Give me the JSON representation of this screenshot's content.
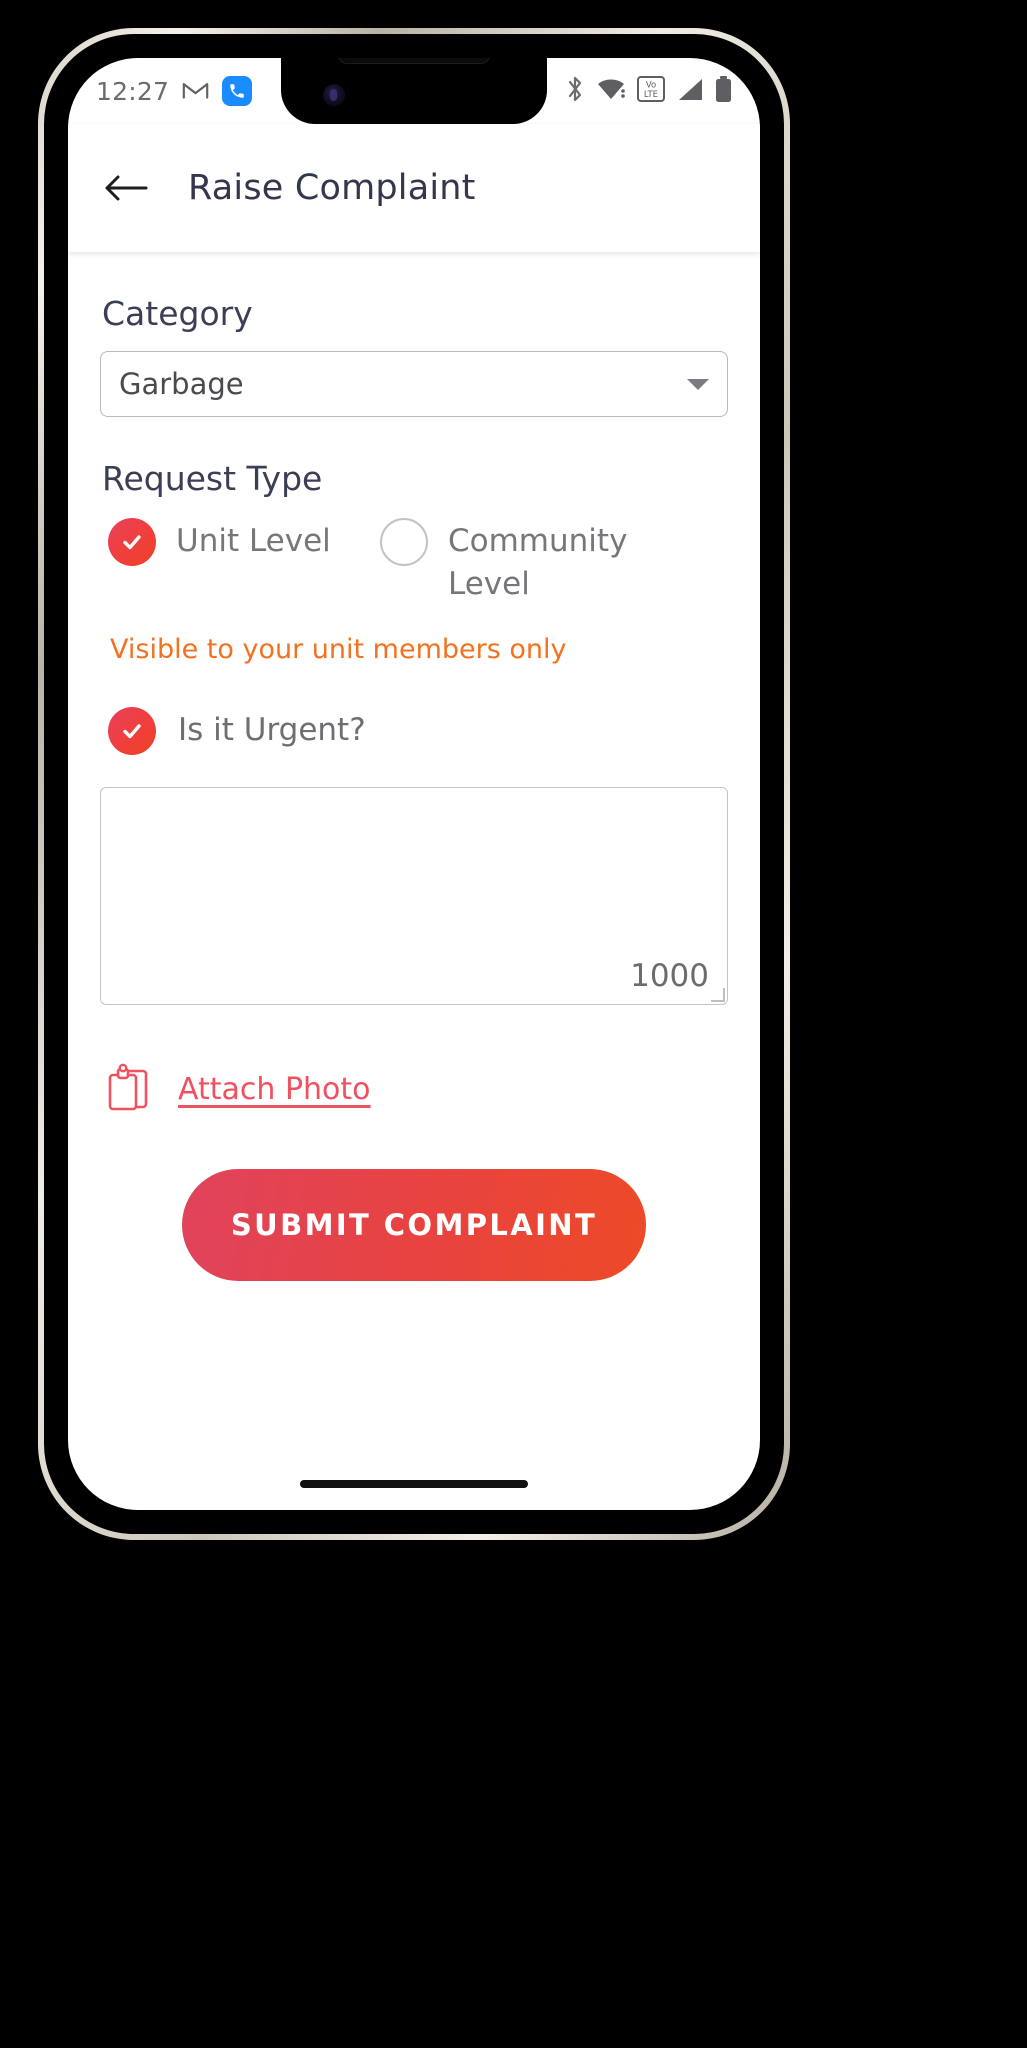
{
  "status_bar": {
    "time": "12:27",
    "left_icons": [
      "gmail-icon",
      "phone-icon"
    ],
    "right_icons": [
      "bluetooth-icon",
      "wifi-icon",
      "volte-icon",
      "cellular-signal-icon",
      "battery-icon"
    ],
    "volte_label": "VoLTE"
  },
  "app_bar": {
    "back_label": "Back",
    "title": "Raise Complaint"
  },
  "form": {
    "category": {
      "label": "Category",
      "selected": "Garbage"
    },
    "request_type": {
      "label": "Request Type",
      "options": [
        {
          "label": "Unit Level",
          "checked": true
        },
        {
          "label": "Community Level",
          "checked": false
        }
      ],
      "hint": "Visible to your unit members only"
    },
    "urgent": {
      "label": "Is it Urgent?",
      "checked": true
    },
    "description": {
      "value": "",
      "placeholder": "",
      "char_remaining": "1000"
    },
    "attach": {
      "label": "Attach Photo",
      "icon": "clipboard-icon"
    },
    "submit": {
      "label": "SUBMIT COMPLAINT"
    }
  },
  "colors": {
    "accent_red": "#ef4023",
    "accent_pink": "#e8405a",
    "link_red": "#f0515f",
    "hint_orange": "#f4711f",
    "title_navy": "#33364d",
    "label_gray": "#77777b"
  }
}
